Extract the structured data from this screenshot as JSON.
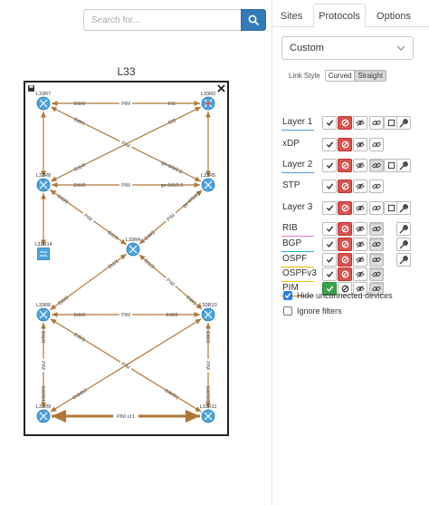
{
  "search": {
    "placeholder": "Search for..."
  },
  "diagram": {
    "title": "L33",
    "routers": [
      {
        "id": "r7",
        "label": "L33R7",
        "kind": "router"
      },
      {
        "id": "r8",
        "label": "L33R8",
        "kind": "router"
      },
      {
        "id": "r14",
        "label": "L33R14",
        "kind": "switch"
      },
      {
        "id": "r6",
        "label": "L33R6",
        "kind": "router"
      },
      {
        "id": "r9",
        "label": "L33R9",
        "kind": "router"
      },
      {
        "id": "r12",
        "label": "L33R12",
        "kind": "router"
      },
      {
        "id": "r3",
        "label": "L33R3",
        "kind": "special"
      },
      {
        "id": "r5",
        "label": "L33R5",
        "kind": "router"
      },
      {
        "id": "r4",
        "label": "L33R4",
        "kind": "router"
      },
      {
        "id": "r10",
        "label": "L33R10",
        "kind": "router"
      },
      {
        "id": "r11",
        "label": "L33R11",
        "kind": "router"
      }
    ],
    "links": [
      {
        "from": "r7",
        "to": "r3",
        "a_label": "Et0/0",
        "mid_label": "PIM",
        "b_label": "Et1"
      },
      {
        "from": "r7",
        "to": "r5",
        "a_label": "Et0/1",
        "mid_label": "PIM",
        "b_label": "ge-0/0/2.0"
      },
      {
        "from": "r3",
        "to": "r8",
        "a_label": "Et3",
        "mid_label": "",
        "b_label": "Et1/0"
      },
      {
        "from": "r8",
        "to": "r7",
        "a_label": "",
        "mid_label": "",
        "b_label": ""
      },
      {
        "from": "r5",
        "to": "r3",
        "a_label": "",
        "mid_label": "",
        "b_label": ""
      },
      {
        "from": "r8",
        "to": "r5",
        "a_label": "Et0/0",
        "mid_label": "PIM",
        "b_label": "ge-0/0/0.0"
      },
      {
        "from": "r8",
        "to": "r4",
        "a_label": "Et0/2",
        "mid_label": "PIM",
        "b_label": "Et1/0"
      },
      {
        "from": "r5",
        "to": "r4",
        "a_label": "ge-0/0/2.0",
        "mid_label": "PIM",
        "b_label": "Et0/2"
      },
      {
        "from": "r14",
        "to": "r8",
        "a_label": "",
        "mid_label": "",
        "b_label": ""
      },
      {
        "from": "r4",
        "to": "r6",
        "a_label": "Et1/1",
        "mid_label": "",
        "b_label": "Et0/2"
      },
      {
        "from": "r4",
        "to": "r10",
        "a_label": "Et1/2",
        "mid_label": "PIM",
        "b_label": "Et0/1"
      },
      {
        "from": "r6",
        "to": "r10",
        "a_label": "Et0/0",
        "mid_label": "PIM",
        "b_label": "Et0/0"
      },
      {
        "from": "r6",
        "to": "r11",
        "a_label": "Et0/3",
        "mid_label": "PIM",
        "b_label": "Gi0/0/1"
      },
      {
        "from": "r10",
        "to": "r9",
        "a_label": "",
        "mid_label": "",
        "b_label": "Gi0/0/2"
      },
      {
        "from": "r6",
        "to": "r9",
        "a_label": "Et1/0",
        "mid_label": "PIM",
        "b_label": "Gi0/0/1"
      },
      {
        "from": "r10",
        "to": "r11",
        "a_label": "Et0/3",
        "mid_label": "PIM",
        "b_label": "Gi0/0/3"
      },
      {
        "from": "r9",
        "to": "r11",
        "a_label": "",
        "mid_label": "PIM x11",
        "b_label": ""
      }
    ]
  },
  "tabs": [
    {
      "label": "Sites",
      "active": false
    },
    {
      "label": "Protocols",
      "active": true
    },
    {
      "label": "Options",
      "active": false
    }
  ],
  "preset": {
    "value": "Custom"
  },
  "link_style": {
    "label": "Link Style",
    "options": [
      "Curved",
      "Straight"
    ],
    "selected": "Straight"
  },
  "protocols": [
    {
      "label": "Layer 1",
      "color": "#5b9bd5",
      "buttons": [
        "check",
        "block",
        "eye",
        "link",
        "square",
        "wrench"
      ]
    },
    {
      "label": "xDP",
      "color": "",
      "buttons": [
        "check",
        "block",
        "eye",
        "link"
      ]
    },
    {
      "label": "Layer 2",
      "color": "#5b9bd5",
      "buttons": [
        "check",
        "block",
        "eye",
        "link",
        "square",
        "wrench"
      ]
    },
    {
      "label": "STP",
      "color": "",
      "buttons": [
        "check",
        "block",
        "eye",
        "link"
      ]
    },
    {
      "label": "Layer 3",
      "color": "",
      "buttons": [
        "check",
        "block",
        "eye",
        "link",
        "square",
        "wrench"
      ]
    },
    {
      "label": "RIB",
      "color": "#e377c2",
      "buttons": [
        "check",
        "block",
        "eye",
        "link",
        "wrench"
      ]
    },
    {
      "label": "BGP",
      "color": "#17becf",
      "buttons": [
        "check",
        "block",
        "eye",
        "link",
        "wrench"
      ]
    },
    {
      "label": "OSPF",
      "color": "#e6b800",
      "buttons": [
        "check",
        "block",
        "eye",
        "link",
        "wrench"
      ]
    },
    {
      "label": "OSPFv3",
      "color": "#f2c200",
      "buttons": [
        "check",
        "block",
        "eye",
        "link"
      ]
    },
    {
      "label": "PIM",
      "color": "#b07838",
      "buttons": [
        "check",
        "block",
        "eye",
        "link"
      ]
    }
  ],
  "options": [
    {
      "label": "Hide unconnected devices",
      "checked": true
    },
    {
      "label": "Ignore filters",
      "checked": false
    }
  ],
  "colors": {
    "link": "#b07838",
    "accent": "#337ab7",
    "node": "#4aa3df"
  }
}
